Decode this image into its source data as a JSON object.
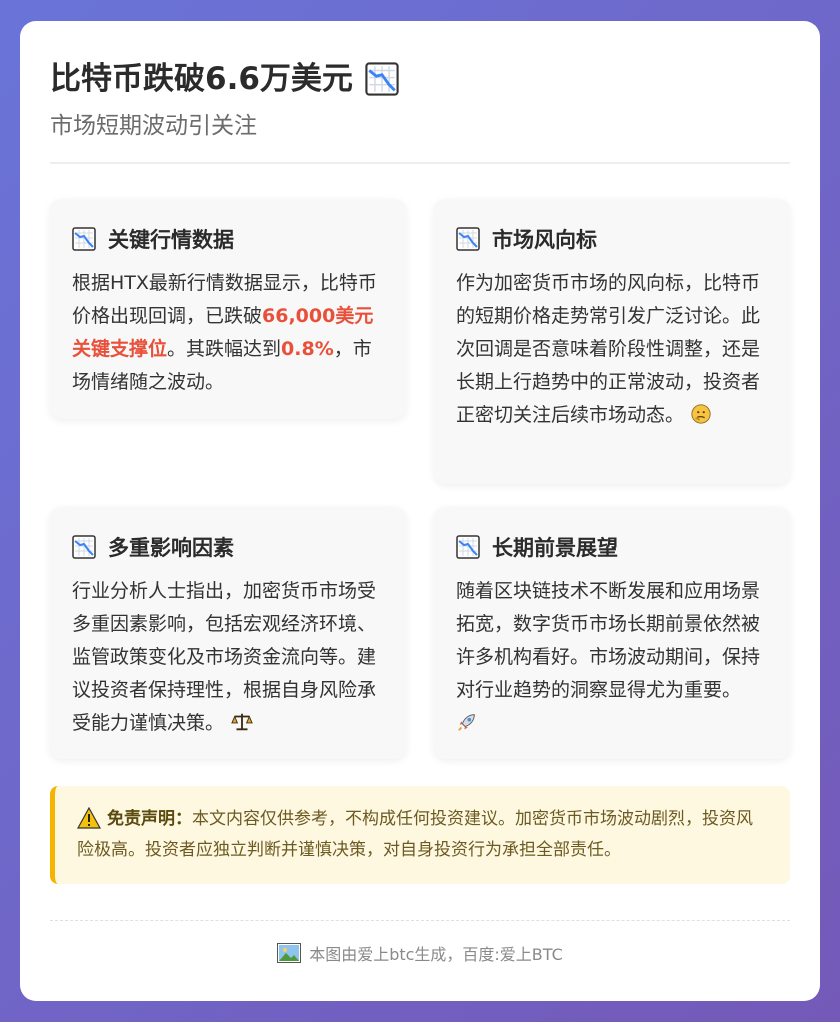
{
  "header": {
    "title": "比特币跌破6.6万美元",
    "title_icon": "chart-decreasing-icon",
    "subtitle": "市场短期波动引关注"
  },
  "cards": [
    {
      "heading": "关键行情数据",
      "icon": "chart-decreasing-icon",
      "text_before": "根据HTX最新行情数据显示，比特币价格出现回调，已跌破",
      "highlight1": "66,000美元关键支撑位",
      "text_middle": "。其跌幅达到",
      "highlight2": "0.8%",
      "text_after": "，市场情绪随之波动。"
    },
    {
      "heading": "市场风向标",
      "icon": "chart-decreasing-icon",
      "text": "作为加密货币市场的风向标，比特币的短期价格走势常引发广泛讨论。此次回调是否意味着阶段性调整，还是长期上行趋势中的正常波动，投资者正密切关注后续市场动态。",
      "emoji": "thinking-face-icon"
    },
    {
      "heading": "多重影响因素",
      "icon": "chart-decreasing-icon",
      "text": "行业分析人士指出，加密货币市场受多重因素影响，包括宏观经济环境、监管政策变化及市场资金流向等。建议投资者保持理性，根据自身风险承受能力谨慎决策。",
      "emoji": "balance-scale-icon"
    },
    {
      "heading": "长期前景展望",
      "icon": "chart-decreasing-icon",
      "text": "随着区块链技术不断发展和应用场景拓宽，数字货币市场长期前景依然被许多机构看好。市场波动期间，保持对行业趋势的洞察显得尤为重要。",
      "emoji": "rocket-icon"
    }
  ],
  "notice": {
    "label": "免责声明：",
    "text": "本文内容仅供参考，不构成任何投资建议。加密货币市场波动剧烈，投资风险极高。投资者应独立判断并谨慎决策，对自身投资行为承担全部责任。",
    "icon": "warning-icon"
  },
  "footer": {
    "text": "本图由爱上btc生成，百度:爱上BTC",
    "icon": "picture-icon"
  },
  "colors": {
    "highlight": "#e8503a",
    "notice_border": "#f4b400",
    "notice_bg": "#fff8e0"
  }
}
